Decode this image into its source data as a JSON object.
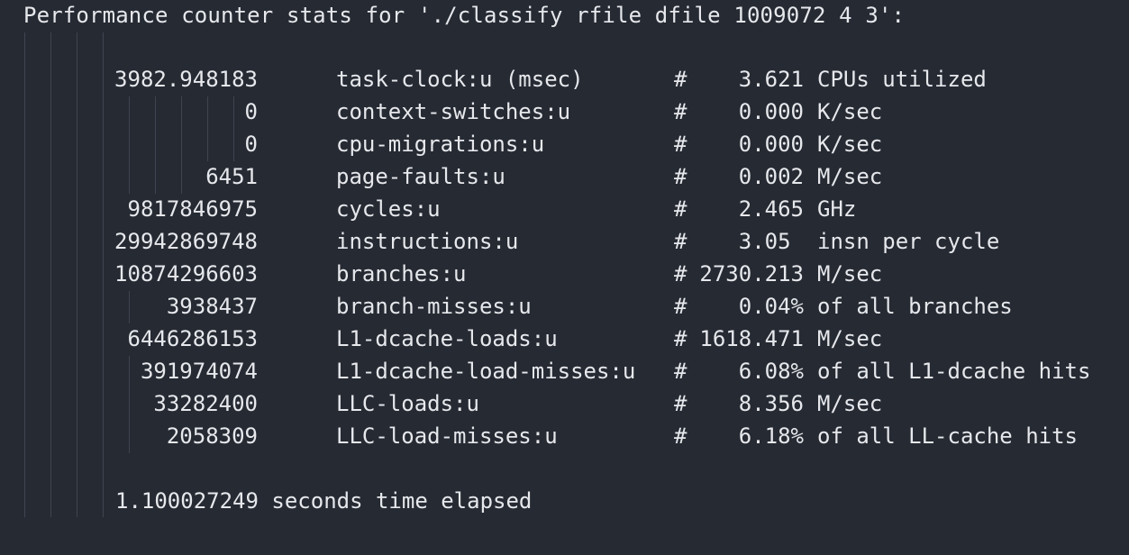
{
  "terminal": {
    "header": "Performance counter stats for './classify rfile dfile 1009072 4 3':",
    "colors": {
      "background": "#262a33",
      "text": "#e6e8ec",
      "guide": "#3f4450"
    },
    "rows": [
      {
        "value": "3982.948183",
        "event": "task-clock:u (msec)",
        "hash": "#",
        "metric": "3.621",
        "unit": "CPUs utilized"
      },
      {
        "value": "0",
        "event": "context-switches:u",
        "hash": "#",
        "metric": "0.000",
        "unit": "K/sec"
      },
      {
        "value": "0",
        "event": "cpu-migrations:u",
        "hash": "#",
        "metric": "0.000",
        "unit": "K/sec"
      },
      {
        "value": "6451",
        "event": "page-faults:u",
        "hash": "#",
        "metric": "0.002",
        "unit": "M/sec"
      },
      {
        "value": "9817846975",
        "event": "cycles:u",
        "hash": "#",
        "metric": "2.465",
        "unit": "GHz"
      },
      {
        "value": "29942869748",
        "event": "instructions:u",
        "hash": "#",
        "metric": "3.05 ",
        "unit": "insn per cycle"
      },
      {
        "value": "10874296603",
        "event": "branches:u",
        "hash": "#",
        "metric": "2730.213",
        "unit": "M/sec"
      },
      {
        "value": "3938437",
        "event": "branch-misses:u",
        "hash": "#",
        "metric": "0.04%",
        "unit": "of all branches"
      },
      {
        "value": "6446286153",
        "event": "L1-dcache-loads:u",
        "hash": "#",
        "metric": "1618.471",
        "unit": "M/sec"
      },
      {
        "value": "391974074",
        "event": "L1-dcache-load-misses:u",
        "hash": "#",
        "metric": "6.08%",
        "unit": "of all L1-dcache hits"
      },
      {
        "value": "33282400",
        "event": "LLC-loads:u",
        "hash": "#",
        "metric": "8.356",
        "unit": "M/sec"
      },
      {
        "value": "2058309",
        "event": "LLC-load-misses:u",
        "hash": "#",
        "metric": "6.18%",
        "unit": "of all LL-cache hits"
      }
    ],
    "elapsed": "1.100027249 seconds time elapsed"
  }
}
